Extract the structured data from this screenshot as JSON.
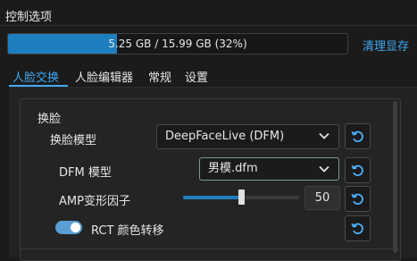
{
  "panel": {
    "title": "控制选项"
  },
  "memory": {
    "text": "5.25 GB / 15.99 GB (32%)",
    "used_fraction": 0.32,
    "clear_label": "清理显存"
  },
  "tabs": [
    {
      "label": "人脸交换",
      "active": true
    },
    {
      "label": "人脸编辑器",
      "active": false
    },
    {
      "label": "常规",
      "active": false
    },
    {
      "label": "设置",
      "active": false
    }
  ],
  "face_swap": {
    "group_title": "换脸",
    "model_label": "换脸模型",
    "model_value": "DeepFaceLive (DFM)",
    "dfm_label": "DFM 模型",
    "dfm_value": "男模.dfm",
    "amp_label": "AMP变形因子",
    "amp_value": "50",
    "amp_slider_fraction": 0.5,
    "rct_label": "RCT 颜色转移",
    "rct_enabled": true
  },
  "icons": {
    "reset": "reset-icon",
    "dropdown": "chevron-down-icon"
  },
  "colors": {
    "accent": "#3fa9f5",
    "progress": "#1e7fbf",
    "toggle_on": "#5a9fd4"
  }
}
